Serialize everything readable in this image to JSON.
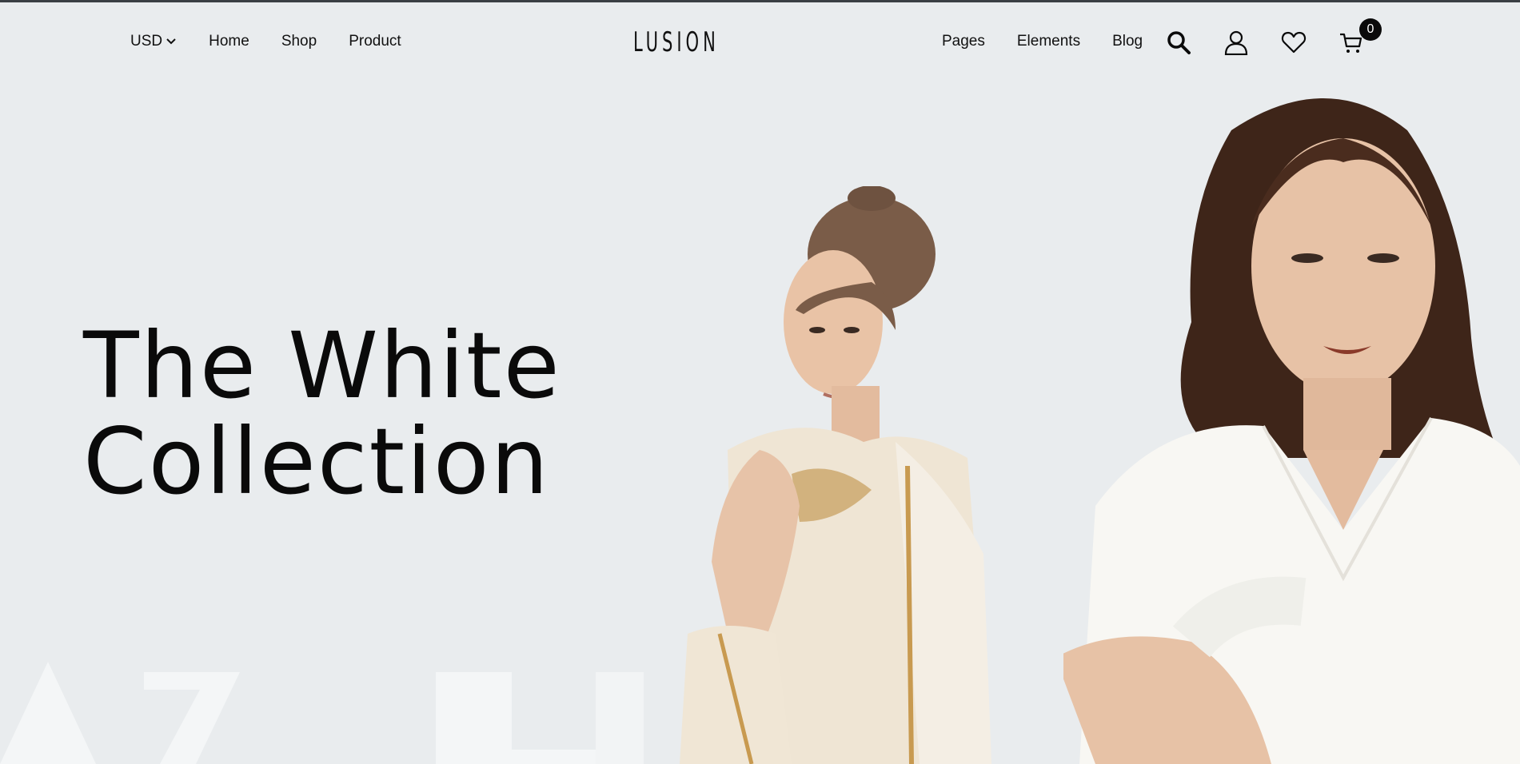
{
  "header": {
    "currency": "USD",
    "nav_left": [
      "Home",
      "Shop",
      "Product"
    ],
    "logo": "LUSION",
    "nav_right": [
      "Pages",
      "Elements",
      "Blog"
    ],
    "cart_count": "0",
    "icons": [
      "search-icon",
      "user-icon",
      "heart-icon",
      "cart-icon"
    ]
  },
  "hero": {
    "title_line1": "The White",
    "title_line2": "Collection"
  },
  "colors": {
    "background": "#e9ecee",
    "text": "#111111",
    "badge": "#0a0a0a"
  }
}
